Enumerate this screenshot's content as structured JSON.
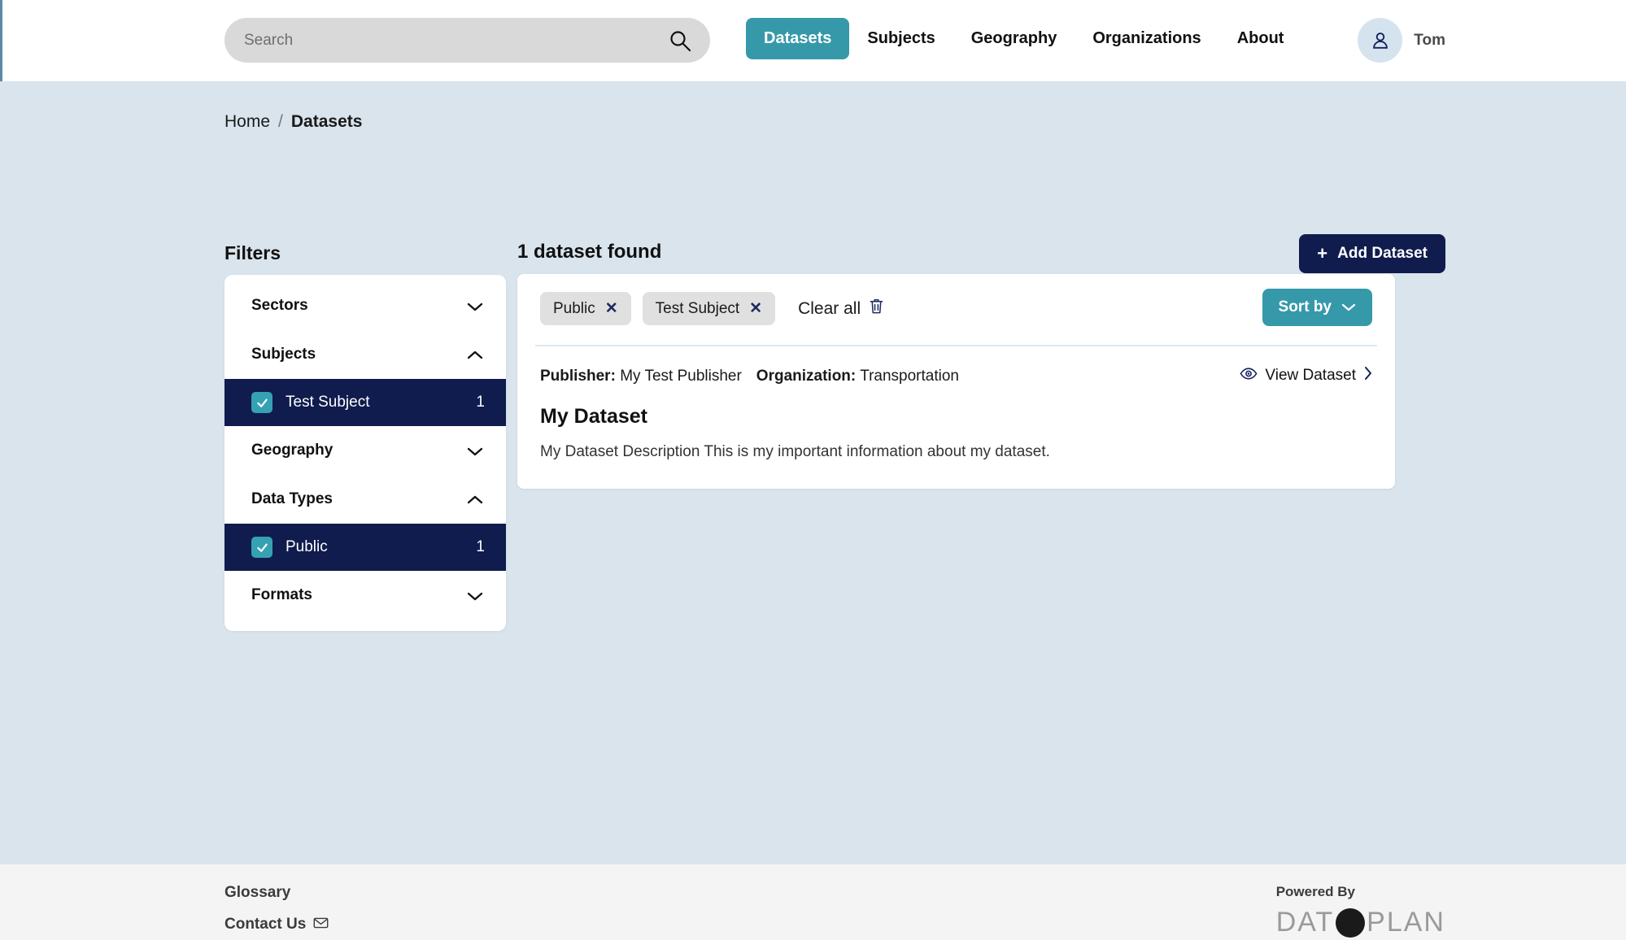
{
  "header": {
    "search": {
      "placeholder": "Search",
      "value": "",
      "icon": "search-icon"
    },
    "nav": [
      {
        "label": "Datasets",
        "active": true
      },
      {
        "label": "Subjects",
        "active": false
      },
      {
        "label": "Geography",
        "active": false
      },
      {
        "label": "Organizations",
        "active": false
      },
      {
        "label": "About",
        "active": false
      }
    ],
    "user": {
      "name": "Tom",
      "avatar_icon": "user-icon"
    }
  },
  "breadcrumb": {
    "home": "Home",
    "separator": "/",
    "current": "Datasets"
  },
  "sidebar": {
    "title": "Filters",
    "groups": [
      {
        "label": "Sectors",
        "expanded": false,
        "options": []
      },
      {
        "label": "Subjects",
        "expanded": true,
        "options": [
          {
            "label": "Test Subject",
            "count": "1",
            "checked": true
          }
        ]
      },
      {
        "label": "Geography",
        "expanded": false,
        "options": []
      },
      {
        "label": "Data Types",
        "expanded": true,
        "options": [
          {
            "label": "Public",
            "count": "1",
            "checked": true
          }
        ]
      },
      {
        "label": "Formats",
        "expanded": false,
        "options": []
      }
    ]
  },
  "main": {
    "result_count_text": "1 dataset found",
    "add_button": {
      "label": "Add Dataset",
      "icon": "plus-icon"
    },
    "chips": [
      {
        "label": "Public",
        "remove_icon": "close-icon"
      },
      {
        "label": "Test Subject",
        "remove_icon": "close-icon"
      }
    ],
    "clear_all": {
      "label": "Clear all",
      "icon": "trash-icon"
    },
    "sort_button": {
      "label": "Sort by",
      "icon": "chevron-down-icon"
    },
    "result": {
      "publisher_key": "Publisher:",
      "publisher_value": "My Test Publisher",
      "organization_key": "Organization:",
      "organization_value": "Transportation",
      "view_link": {
        "label": "View Dataset",
        "icon": "eye-icon",
        "arrow": "chevron-right-icon"
      },
      "title": "My Dataset",
      "description": "My Dataset Description This is my important information about my dataset."
    }
  },
  "footer": {
    "glossary": "Glossary",
    "contact": "Contact Us",
    "contact_icon": "mail-icon",
    "powered_by": "Powered By",
    "logo_left": "DAT",
    "logo_right": "PLAN"
  },
  "colors": {
    "navy": "#0f1c4d",
    "teal": "#3699aa",
    "teal_check": "#35a1b3",
    "page_bg": "#d9e4ed",
    "chip_bg": "#e0e0e0",
    "footer_bg": "#f4f4f4"
  }
}
